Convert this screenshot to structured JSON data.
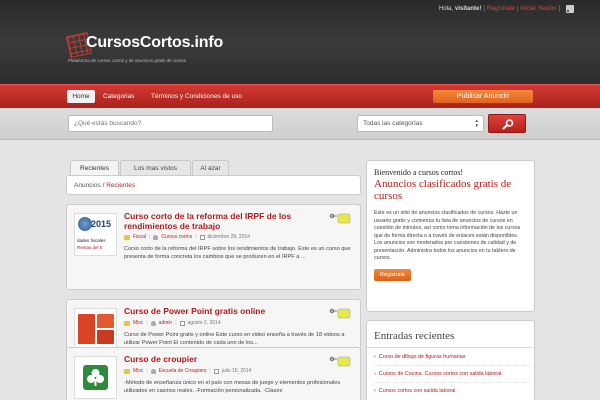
{
  "topbar": {
    "greeting": "Hola,",
    "visitor": "visitante!",
    "open_bracket": "[",
    "register": "Regístrate",
    "divider": "|",
    "login": "Iniciar Sesión",
    "close_bracket": "]",
    "rss_icon": "rss-icon"
  },
  "site": {
    "title": "CursosCortos.info",
    "tagline": "Plataforma de  cursos cortos y de anuncios  gratis de cursos"
  },
  "nav": {
    "home": "Home",
    "categories": "Categorias",
    "terms": "Términos y Condiciones de uso",
    "publish": "Publicar Anuncio"
  },
  "search": {
    "placeholder": "¿Qué estás buscando?",
    "category_selected": "Todas las categorías",
    "button_icon": "search-icon"
  },
  "tabs": [
    "Recientes",
    "Los mas vistos",
    "Al azar"
  ],
  "breadcrumb": {
    "link": "Anuncios",
    "separator": "/",
    "current": "Recientes"
  },
  "listings": [
    {
      "title": "Curso corto de la reforma del IRPF de los rendimientos de trabajo",
      "category": "Fiscal",
      "author": "Cursos cortos",
      "date": "diciembre 28, 2014",
      "description": "Curso corto de la reforma del IRPF sobre los rendimientos de trabajo. Este es un curso que presenta de forma concreta los cambios que se producen en el IRPF a ...",
      "thumb_year": "2015",
      "thumb_line1": "dades fiscales",
      "thumb_line2": "Rentas del tr"
    },
    {
      "title": "Curso de Power Point gratis online",
      "category": "Misc",
      "author": "admin",
      "date": "agosto 2, 2014",
      "description": "Curso de Power Point gratis y online Este curso en video enseña a través de 18 videos a utilizar Power Point  El contenido de cada uno de los..."
    },
    {
      "title": "Curso de croupier",
      "category": "Misc",
      "author": "Escuela de Croupiers",
      "date": "julio 15, 2014",
      "description": "-Método de enseñanza único en el país con mesas de juego y elementos profesionales utilizados en casinos reales. -Formación personalizada. -Clases"
    }
  ],
  "welcome": {
    "hello": "Bienvenido a cursos cortos!",
    "title": "Anuncios clasificados gratis de cursos",
    "body": "Este es un sitio de anuncios clasificados de cursos. Házte un usuario gratis y comienza tu lista de anuncios de cursos en cuestión de minutos, así como toma información de los cursos que de forma directa o a través de enlaces están disponibles. Los anuncios son moderados por cuestiones de calidad y de presentación. Administra todos los anuncios en tu tablero de cursos.",
    "register_button": "Registrate"
  },
  "recent_entries": {
    "title": "Entradas recientes",
    "items": [
      "Curso de dibujo de figuras humanas",
      "Cursos de Cocina. Cursos cortos con salida laboral.",
      "Cursos cortos con salida laboral"
    ]
  },
  "colors": {
    "accent_red": "#b31b1b",
    "nav_red": "#c0302a",
    "orange": "#e8722a"
  }
}
